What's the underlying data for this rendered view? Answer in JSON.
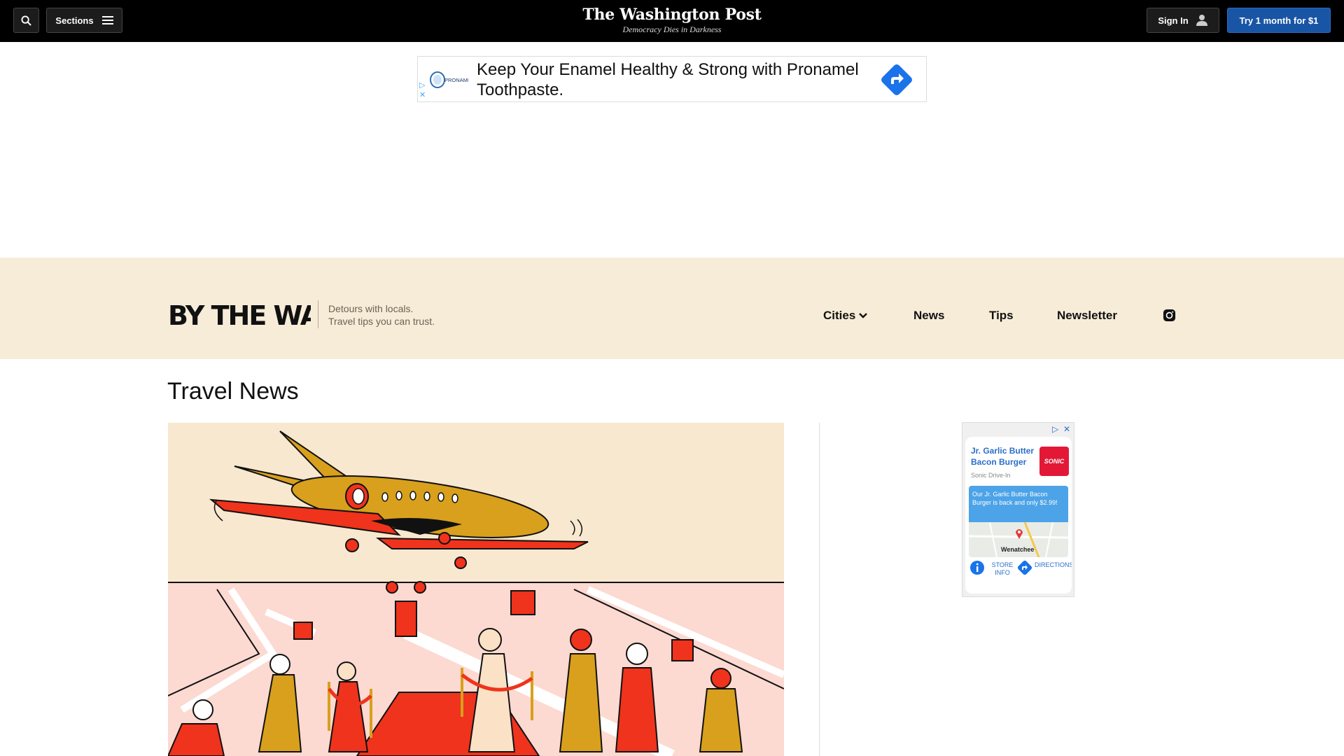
{
  "header": {
    "sections_label": "Sections",
    "logo": "The Washington Post",
    "tagline": "Democracy Dies in Darkness",
    "signin_label": "Sign In",
    "subscribe_label": "Try 1 month for $1"
  },
  "top_ad": {
    "brand_logo_text": "PRONAMEL",
    "text": "Keep Your Enamel Healthy & Strong with Pronamel Toothpaste."
  },
  "section_band": {
    "logo_text": "BY THE WAY",
    "tagline_line1": "Detours with locals.",
    "tagline_line2": "Travel tips you can trust.",
    "nav": [
      "Cities",
      "News",
      "Tips",
      "Newsletter"
    ],
    "bg_color": "#f7ecd8"
  },
  "main": {
    "page_title": "Travel News"
  },
  "side_ad": {
    "title": "Jr. Garlic Butter Bacon Burger",
    "brand": "Sonic Drive-In",
    "logo_text": "SONIC",
    "promo": "Our Jr. Garlic Butter Bacon Burger is back and only $2.99!",
    "map_label": "Wenatchee",
    "store_info": "STORE INFO",
    "directions": "DIRECTIONS"
  },
  "colors": {
    "topbar": "#000000",
    "subscribe": "#1955a5",
    "hero_top": "#f7e8cf",
    "hero_bottom": "#fcd9d1",
    "plane": "#d8a01c",
    "accent_red": "#f0331c"
  }
}
